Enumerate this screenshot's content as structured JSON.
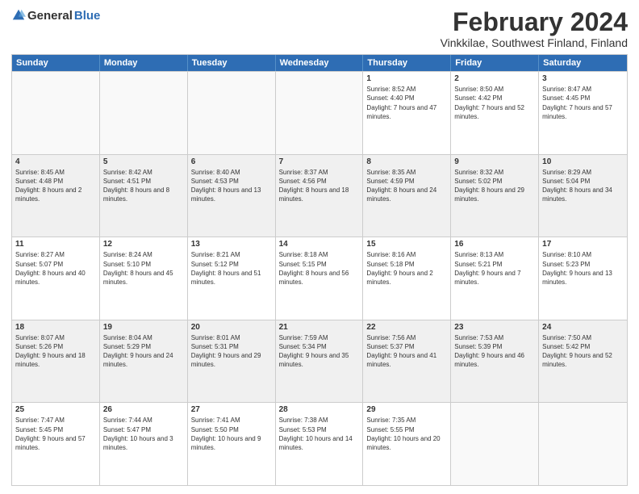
{
  "logo": {
    "general": "General",
    "blue": "Blue"
  },
  "header": {
    "month": "February 2024",
    "location": "Vinkkilae, Southwest Finland, Finland"
  },
  "days": [
    "Sunday",
    "Monday",
    "Tuesday",
    "Wednesday",
    "Thursday",
    "Friday",
    "Saturday"
  ],
  "weeks": [
    [
      {
        "day": "",
        "empty": true
      },
      {
        "day": "",
        "empty": true
      },
      {
        "day": "",
        "empty": true
      },
      {
        "day": "",
        "empty": true
      },
      {
        "day": "1",
        "sunrise": "8:52 AM",
        "sunset": "4:40 PM",
        "daylight": "7 hours and 47 minutes."
      },
      {
        "day": "2",
        "sunrise": "8:50 AM",
        "sunset": "4:42 PM",
        "daylight": "7 hours and 52 minutes."
      },
      {
        "day": "3",
        "sunrise": "8:47 AM",
        "sunset": "4:45 PM",
        "daylight": "7 hours and 57 minutes."
      }
    ],
    [
      {
        "day": "4",
        "sunrise": "8:45 AM",
        "sunset": "4:48 PM",
        "daylight": "8 hours and 2 minutes."
      },
      {
        "day": "5",
        "sunrise": "8:42 AM",
        "sunset": "4:51 PM",
        "daylight": "8 hours and 8 minutes."
      },
      {
        "day": "6",
        "sunrise": "8:40 AM",
        "sunset": "4:53 PM",
        "daylight": "8 hours and 13 minutes."
      },
      {
        "day": "7",
        "sunrise": "8:37 AM",
        "sunset": "4:56 PM",
        "daylight": "8 hours and 18 minutes."
      },
      {
        "day": "8",
        "sunrise": "8:35 AM",
        "sunset": "4:59 PM",
        "daylight": "8 hours and 24 minutes."
      },
      {
        "day": "9",
        "sunrise": "8:32 AM",
        "sunset": "5:02 PM",
        "daylight": "8 hours and 29 minutes."
      },
      {
        "day": "10",
        "sunrise": "8:29 AM",
        "sunset": "5:04 PM",
        "daylight": "8 hours and 34 minutes."
      }
    ],
    [
      {
        "day": "11",
        "sunrise": "8:27 AM",
        "sunset": "5:07 PM",
        "daylight": "8 hours and 40 minutes."
      },
      {
        "day": "12",
        "sunrise": "8:24 AM",
        "sunset": "5:10 PM",
        "daylight": "8 hours and 45 minutes."
      },
      {
        "day": "13",
        "sunrise": "8:21 AM",
        "sunset": "5:12 PM",
        "daylight": "8 hours and 51 minutes."
      },
      {
        "day": "14",
        "sunrise": "8:18 AM",
        "sunset": "5:15 PM",
        "daylight": "8 hours and 56 minutes."
      },
      {
        "day": "15",
        "sunrise": "8:16 AM",
        "sunset": "5:18 PM",
        "daylight": "9 hours and 2 minutes."
      },
      {
        "day": "16",
        "sunrise": "8:13 AM",
        "sunset": "5:21 PM",
        "daylight": "9 hours and 7 minutes."
      },
      {
        "day": "17",
        "sunrise": "8:10 AM",
        "sunset": "5:23 PM",
        "daylight": "9 hours and 13 minutes."
      }
    ],
    [
      {
        "day": "18",
        "sunrise": "8:07 AM",
        "sunset": "5:26 PM",
        "daylight": "9 hours and 18 minutes."
      },
      {
        "day": "19",
        "sunrise": "8:04 AM",
        "sunset": "5:29 PM",
        "daylight": "9 hours and 24 minutes."
      },
      {
        "day": "20",
        "sunrise": "8:01 AM",
        "sunset": "5:31 PM",
        "daylight": "9 hours and 29 minutes."
      },
      {
        "day": "21",
        "sunrise": "7:59 AM",
        "sunset": "5:34 PM",
        "daylight": "9 hours and 35 minutes."
      },
      {
        "day": "22",
        "sunrise": "7:56 AM",
        "sunset": "5:37 PM",
        "daylight": "9 hours and 41 minutes."
      },
      {
        "day": "23",
        "sunrise": "7:53 AM",
        "sunset": "5:39 PM",
        "daylight": "9 hours and 46 minutes."
      },
      {
        "day": "24",
        "sunrise": "7:50 AM",
        "sunset": "5:42 PM",
        "daylight": "9 hours and 52 minutes."
      }
    ],
    [
      {
        "day": "25",
        "sunrise": "7:47 AM",
        "sunset": "5:45 PM",
        "daylight": "9 hours and 57 minutes."
      },
      {
        "day": "26",
        "sunrise": "7:44 AM",
        "sunset": "5:47 PM",
        "daylight": "10 hours and 3 minutes."
      },
      {
        "day": "27",
        "sunrise": "7:41 AM",
        "sunset": "5:50 PM",
        "daylight": "10 hours and 9 minutes."
      },
      {
        "day": "28",
        "sunrise": "7:38 AM",
        "sunset": "5:53 PM",
        "daylight": "10 hours and 14 minutes."
      },
      {
        "day": "29",
        "sunrise": "7:35 AM",
        "sunset": "5:55 PM",
        "daylight": "10 hours and 20 minutes."
      },
      {
        "day": "",
        "empty": true
      },
      {
        "day": "",
        "empty": true
      }
    ]
  ]
}
